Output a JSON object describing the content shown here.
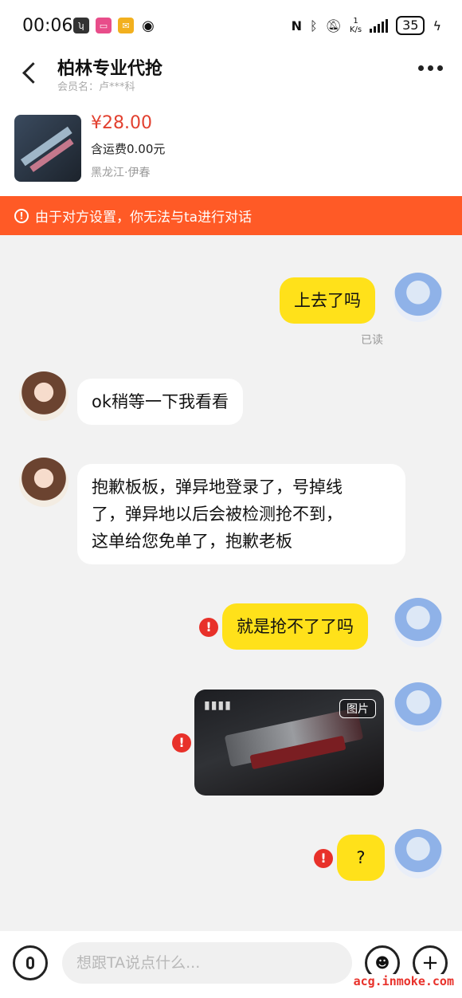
{
  "status_bar": {
    "time": "00:06",
    "net_speed_value": "1",
    "net_speed_unit": "K/s",
    "battery": "35"
  },
  "header": {
    "title": "柏林专业代抢",
    "subtitle": "会员名：卢***科"
  },
  "product": {
    "price": "¥28.00",
    "shipping": "含运费0.00元",
    "location": "黑龙江·伊春"
  },
  "warning": {
    "text": "由于对方设置，你无法与ta进行对话"
  },
  "messages": [
    {
      "from": "me",
      "text": "上去了吗",
      "status": "已读"
    },
    {
      "from": "other",
      "text": "ok稍等一下我看看"
    },
    {
      "from": "other",
      "lines": [
        "抱歉板板，弹异地登录了，号掉线",
        "了，弹异地以后会被检测抢不到，",
        "这单给您免单了，抱歉老板"
      ]
    },
    {
      "from": "me",
      "text": "就是抢不了了吗",
      "failed": true
    },
    {
      "from": "me",
      "type": "image",
      "tag": "图片",
      "failed": true
    },
    {
      "from": "me",
      "text": "?",
      "failed": true
    }
  ],
  "input": {
    "placeholder": "想跟TA说点什么..."
  },
  "watermark": "acg.inmoke.com",
  "colors": {
    "accent_orange": "#ff5a26",
    "bubble_me": "#ffe11a",
    "price_red": "#e2402f",
    "fail_red": "#e8312a"
  }
}
